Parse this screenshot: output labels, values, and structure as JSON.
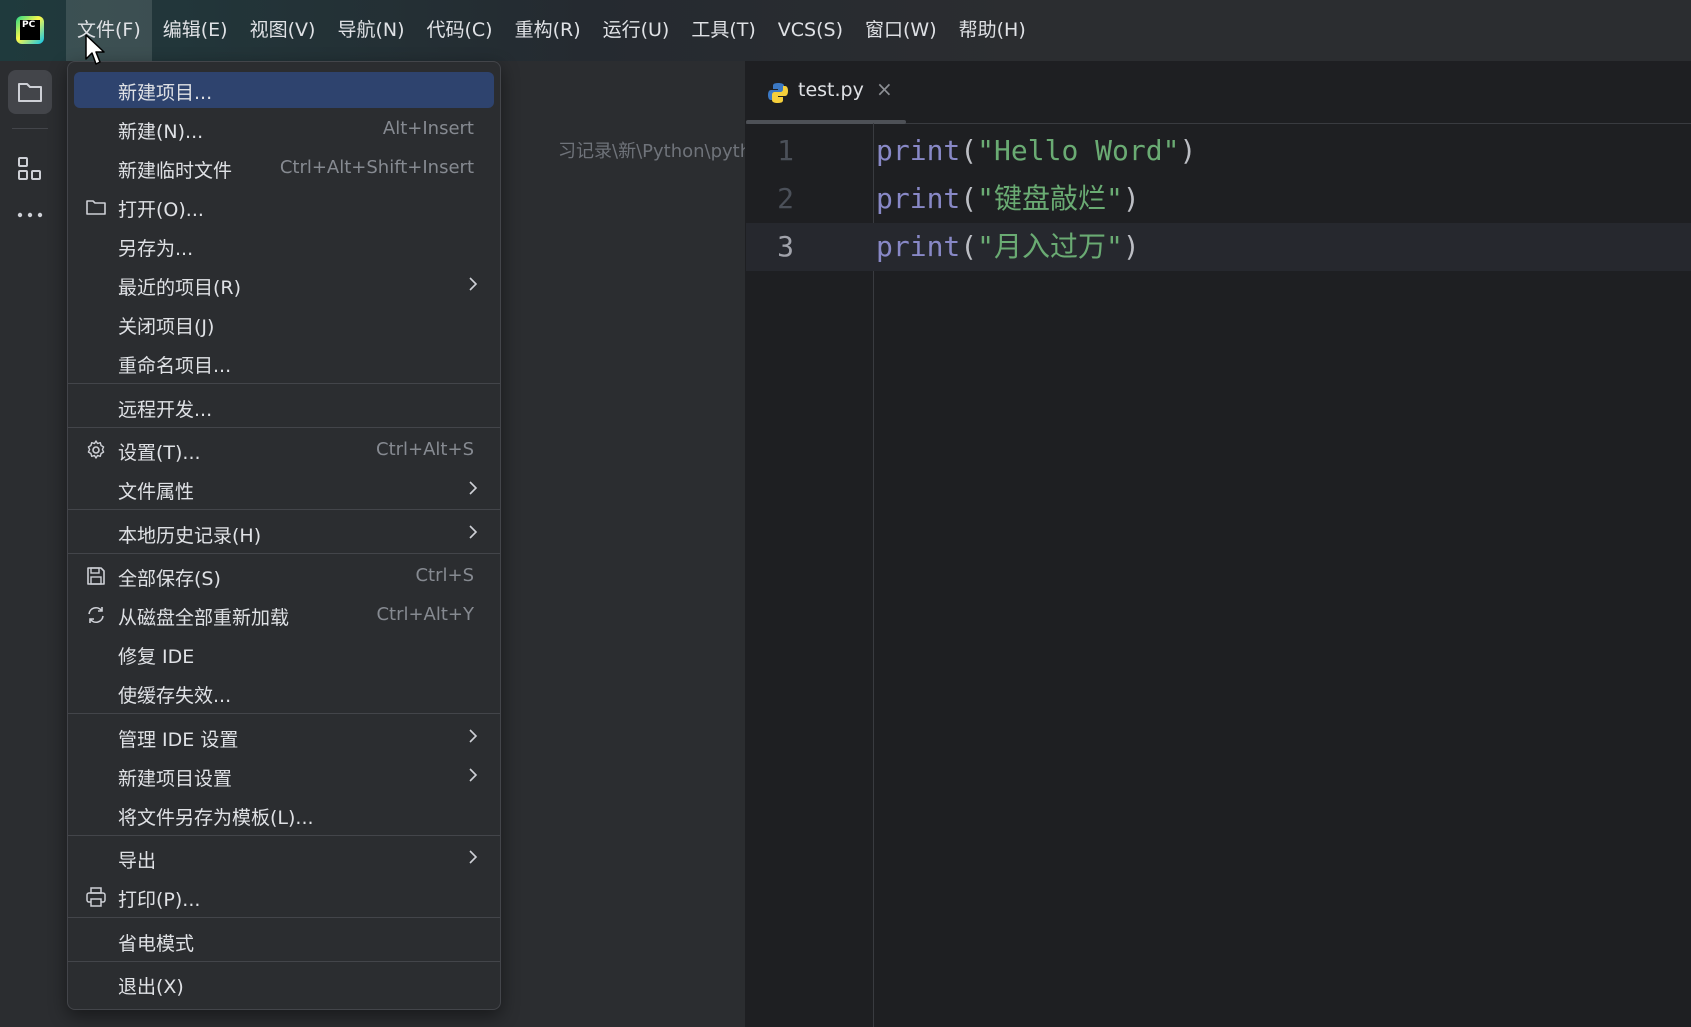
{
  "menubar": {
    "items": [
      "文件(F)",
      "编辑(E)",
      "视图(V)",
      "导航(N)",
      "代码(C)",
      "重构(R)",
      "运行(U)",
      "工具(T)",
      "VCS(S)",
      "窗口(W)",
      "帮助(H)"
    ],
    "active_index": 0
  },
  "logo": {
    "text": "PC"
  },
  "project_panel": {
    "path_fragment": "习记录\\新\\Python\\python-le"
  },
  "editor": {
    "tab": {
      "label": "test.py",
      "close": "×"
    },
    "lines": [
      {
        "number": "1",
        "keyword": "print",
        "open": "(",
        "string": "\"Hello Word\"",
        "close": ")"
      },
      {
        "number": "2",
        "keyword": "print",
        "open": "(",
        "string": "\"键盘敲烂\"",
        "close": ")"
      },
      {
        "number": "3",
        "keyword": "print",
        "open": "(",
        "string": "\"月入过万\"",
        "close": ")"
      }
    ],
    "current_line": 3
  },
  "file_menu": {
    "items": [
      {
        "label": "新建项目...",
        "shortcut": ""
      },
      {
        "label": "新建(N)...",
        "shortcut": "Alt+Insert"
      },
      {
        "label": "新建临时文件",
        "shortcut": "Ctrl+Alt+Shift+Insert"
      },
      {
        "label": "打开(O)...",
        "shortcut": "",
        "icon": "folder-icon"
      },
      {
        "label": "另存为...",
        "shortcut": ""
      },
      {
        "label": "最近的项目(R)",
        "shortcut": "",
        "submenu": true
      },
      {
        "label": "关闭项目(J)",
        "shortcut": ""
      },
      {
        "label": "重命名项目...",
        "shortcut": ""
      },
      {
        "label": "远程开发...",
        "shortcut": ""
      },
      {
        "label": "设置(T)...",
        "shortcut": "Ctrl+Alt+S",
        "icon": "gear-icon"
      },
      {
        "label": "文件属性",
        "shortcut": "",
        "submenu": true
      },
      {
        "label": "本地历史记录(H)",
        "shortcut": "",
        "submenu": true
      },
      {
        "label": "全部保存(S)",
        "shortcut": "Ctrl+S",
        "icon": "save-icon"
      },
      {
        "label": "从磁盘全部重新加载",
        "shortcut": "Ctrl+Alt+Y",
        "icon": "reload-icon"
      },
      {
        "label": "修复 IDE",
        "shortcut": ""
      },
      {
        "label": "使缓存失效...",
        "shortcut": ""
      },
      {
        "label": "管理 IDE 设置",
        "shortcut": "",
        "submenu": true
      },
      {
        "label": "新建项目设置",
        "shortcut": "",
        "submenu": true
      },
      {
        "label": "将文件另存为模板(L)...",
        "shortcut": ""
      },
      {
        "label": "导出",
        "shortcut": "",
        "submenu": true
      },
      {
        "label": "打印(P)...",
        "shortcut": "",
        "icon": "printer-icon"
      },
      {
        "label": "省电模式",
        "shortcut": ""
      },
      {
        "label": "退出(X)",
        "shortcut": ""
      }
    ],
    "selected_index": 0
  },
  "colors": {
    "accent_selection": "#2e436e",
    "keyword": "#8888c6",
    "string": "#6aab73"
  }
}
